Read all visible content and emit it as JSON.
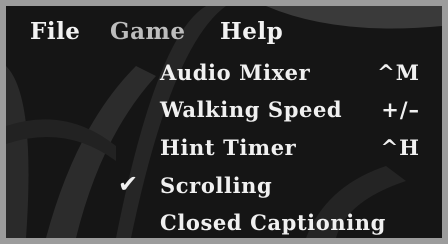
{
  "menubar": {
    "file": "File",
    "game": "Game",
    "help": "Help",
    "open_menu": "Game"
  },
  "game_menu": {
    "items": [
      {
        "label": "Audio Mixer",
        "shortcut": "^M",
        "checked": false
      },
      {
        "label": "Walking Speed",
        "shortcut": "+/–",
        "checked": false
      },
      {
        "label": "Hint Timer",
        "shortcut": "^H",
        "checked": false
      },
      {
        "label": "Scrolling",
        "shortcut": "",
        "checked": true
      },
      {
        "label": "Closed Captioning",
        "shortcut": "",
        "checked": false
      }
    ],
    "check_glyph": "✔"
  },
  "colors": {
    "menu_text": "#f0f0f0",
    "open_menu_text": "#bdbdbd",
    "background": "#151515",
    "frame": "#9c9c9c"
  }
}
